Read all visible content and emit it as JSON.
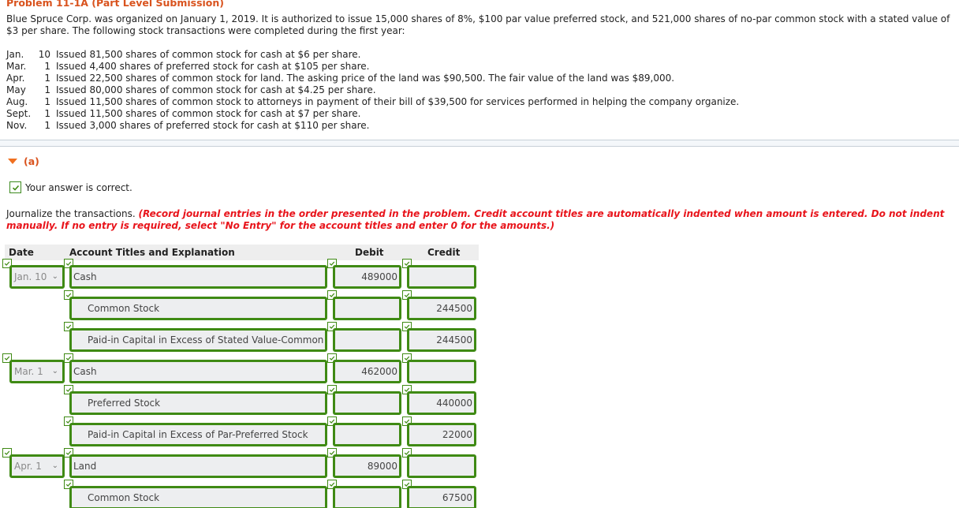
{
  "problem": {
    "title": "Problem 11-1A (Part Level Submission)",
    "description": "Blue Spruce Corp. was organized on January 1, 2019. It is authorized to issue 15,000 shares of 8%, $100 par value preferred stock, and 521,000 shares of no-par common stock with a stated value of $3 per share. The following stock transactions were completed during the first year:",
    "transactions": [
      {
        "month": "Jan.",
        "day": "10",
        "text": "Issued 81,500 shares of common stock for cash at $6 per share."
      },
      {
        "month": "Mar.",
        "day": "1",
        "text": "Issued 4,400 shares of preferred stock for cash at $105 per share."
      },
      {
        "month": "Apr.",
        "day": "1",
        "text": "Issued 22,500 shares of common stock for land. The asking price of the land was $90,500. The fair value of the land was $89,000."
      },
      {
        "month": "May",
        "day": "1",
        "text": "Issued 80,000 shares of common stock for cash at $4.25 per share."
      },
      {
        "month": "Aug.",
        "day": "1",
        "text": "Issued 11,500 shares of common stock to attorneys in payment of their bill of $39,500 for services performed in helping the company organize."
      },
      {
        "month": "Sept.",
        "day": "1",
        "text": "Issued 11,500 shares of common stock for cash at $7 per share."
      },
      {
        "month": "Nov.",
        "day": "1",
        "text": "Issued 3,000 shares of preferred stock for cash at $110 per share."
      }
    ]
  },
  "part": {
    "label": "(a)",
    "status": "Your answer is correct.",
    "instruction_plain": "Journalize the transactions. ",
    "instruction_red": "(Record journal entries in the order presented in the problem. Credit account titles are automatically indented when amount is entered. Do not indent manually. If no entry is required, select \"No Entry\" for the account titles and enter 0 for the amounts.)"
  },
  "journal": {
    "headers": {
      "date": "Date",
      "account": "Account Titles and Explanation",
      "debit": "Debit",
      "credit": "Credit"
    },
    "rows": [
      {
        "date": "Jan. 10",
        "account": "Cash",
        "debit": "489000",
        "credit": ""
      },
      {
        "date": "",
        "account": "Common Stock",
        "debit": "",
        "credit": "244500"
      },
      {
        "date": "",
        "account": "Paid-in Capital in Excess of Stated Value-Common Stock",
        "debit": "",
        "credit": "244500"
      },
      {
        "date": "Mar. 1",
        "account": "Cash",
        "debit": "462000",
        "credit": ""
      },
      {
        "date": "",
        "account": "Preferred Stock",
        "debit": "",
        "credit": "440000"
      },
      {
        "date": "",
        "account": "Paid-in Capital in Excess of Par-Preferred Stock",
        "debit": "",
        "credit": "22000"
      },
      {
        "date": "Apr. 1",
        "account": "Land",
        "debit": "89000",
        "credit": ""
      },
      {
        "date": "",
        "account": "Common Stock",
        "debit": "",
        "credit": "67500"
      }
    ]
  },
  "colors": {
    "title": "#d9531e",
    "instruction_red": "#e8141b",
    "correct_green": "#3f8a14",
    "field_bg": "#edeef0"
  }
}
